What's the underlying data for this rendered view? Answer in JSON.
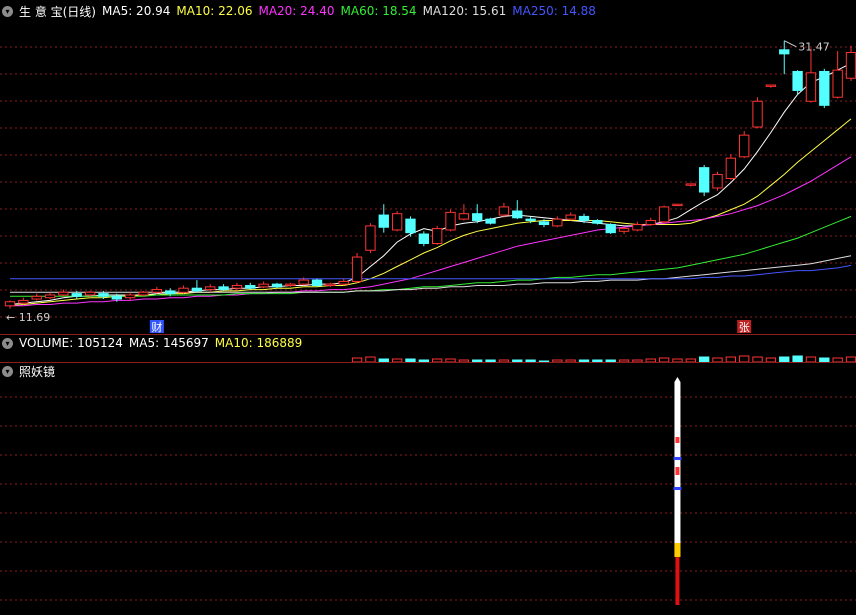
{
  "main_header": {
    "title": "生 意 宝(日线)",
    "indicators": [
      {
        "label": "MA5: 20.94",
        "color": "#ffffff"
      },
      {
        "label": "MA10: 22.06",
        "color": "#ffff44"
      },
      {
        "label": "MA20: 24.40",
        "color": "#ff33ff"
      },
      {
        "label": "MA60: 18.54",
        "color": "#33ee33"
      },
      {
        "label": "MA120: 15.61",
        "color": "#dddddd"
      },
      {
        "label": "MA250: 14.88",
        "color": "#4455ff"
      }
    ]
  },
  "volume_header": {
    "indicators": [
      {
        "label": "VOLUME: 105124",
        "color": "#ffffff"
      },
      {
        "label": "MA5: 145697",
        "color": "#ffffff"
      },
      {
        "label": "MA10: 186889",
        "color": "#ffff44"
      }
    ]
  },
  "indicator_header": {
    "title": "照妖镜"
  },
  "colors": {
    "up": "#ff3333",
    "down": "#54ffff",
    "grid": "#8a1e1e"
  },
  "chart_data": {
    "type": "candlestick",
    "price_range": [
      11.0,
      33.0
    ],
    "high_label": "31.47",
    "low_label": "11.69",
    "markers": [
      {
        "index": 11,
        "text": "财",
        "color": "#3355ff"
      },
      {
        "index": 55,
        "text": "张",
        "color": "#bb2222"
      }
    ],
    "candles": [
      [
        11.9,
        12.2,
        11.69,
        12.3
      ],
      [
        12.1,
        12.3,
        12.0,
        12.5
      ],
      [
        12.4,
        12.6,
        12.3,
        12.8
      ],
      [
        12.5,
        12.7,
        12.4,
        12.9
      ],
      [
        12.7,
        12.9,
        12.6,
        13.1
      ],
      [
        12.8,
        12.6,
        12.4,
        13.0
      ],
      [
        12.7,
        12.9,
        12.5,
        13.0
      ],
      [
        12.8,
        12.6,
        12.4,
        13.0
      ],
      [
        12.6,
        12.4,
        12.2,
        12.8
      ],
      [
        12.5,
        12.7,
        12.3,
        12.9
      ],
      [
        12.7,
        12.9,
        12.6,
        13.0
      ],
      [
        12.9,
        13.1,
        12.8,
        13.3
      ],
      [
        13.0,
        12.8,
        12.6,
        13.2
      ],
      [
        12.9,
        13.2,
        12.8,
        13.4
      ],
      [
        13.2,
        13.0,
        12.9,
        13.8
      ],
      [
        13.1,
        13.3,
        12.9,
        13.5
      ],
      [
        13.3,
        13.1,
        13.0,
        13.5
      ],
      [
        13.2,
        13.4,
        13.0,
        13.6
      ],
      [
        13.4,
        13.2,
        13.1,
        13.6
      ],
      [
        13.3,
        13.5,
        13.2,
        13.7
      ],
      [
        13.5,
        13.3,
        13.2,
        13.6
      ],
      [
        13.4,
        13.5,
        13.3,
        13.6
      ],
      [
        13.5,
        13.8,
        13.4,
        14.0
      ],
      [
        13.8,
        13.4,
        13.3,
        13.9
      ],
      [
        13.4,
        13.5,
        13.3,
        13.6
      ],
      [
        13.5,
        13.7,
        13.4,
        13.9
      ],
      [
        13.7,
        15.5,
        13.6,
        15.8
      ],
      [
        16.0,
        17.8,
        15.8,
        18.0
      ],
      [
        18.6,
        17.7,
        17.3,
        19.4
      ],
      [
        17.5,
        18.7,
        17.4,
        18.9
      ],
      [
        18.3,
        17.3,
        17.0,
        18.5
      ],
      [
        17.2,
        16.5,
        16.3,
        17.4
      ],
      [
        16.5,
        17.6,
        16.4,
        17.8
      ],
      [
        17.5,
        18.8,
        17.4,
        19.0
      ],
      [
        18.3,
        18.7,
        18.2,
        19.4
      ],
      [
        18.7,
        18.2,
        18.0,
        19.4
      ],
      [
        18.3,
        18.0,
        17.9,
        18.4
      ],
      [
        18.6,
        19.2,
        18.4,
        19.5
      ],
      [
        18.9,
        18.4,
        18.3,
        19.7
      ],
      [
        18.3,
        18.2,
        18.0,
        18.5
      ],
      [
        18.1,
        17.9,
        17.7,
        18.3
      ],
      [
        17.8,
        18.3,
        17.7,
        18.5
      ],
      [
        18.3,
        18.6,
        18.2,
        18.8
      ],
      [
        18.5,
        18.2,
        18.0,
        18.7
      ],
      [
        18.2,
        18.0,
        17.9,
        18.3
      ],
      [
        17.9,
        17.3,
        17.2,
        18.0
      ],
      [
        17.4,
        17.6,
        17.2,
        17.7
      ],
      [
        17.5,
        17.9,
        17.4,
        18.1
      ],
      [
        17.9,
        18.2,
        17.8,
        18.4
      ],
      [
        18.1,
        19.2,
        18.0,
        19.3
      ],
      [
        19.3,
        19.4,
        19.3,
        19.4
      ],
      [
        20.8,
        20.9,
        20.7,
        20.9
      ],
      [
        22.1,
        20.3,
        20.0,
        22.3
      ],
      [
        20.6,
        21.6,
        20.4,
        21.8
      ],
      [
        21.3,
        22.8,
        21.2,
        23.1
      ],
      [
        22.9,
        24.5,
        22.8,
        24.8
      ],
      [
        25.1,
        27.0,
        25.0,
        27.3
      ],
      [
        28.1,
        28.2,
        28.0,
        28.2
      ],
      [
        30.8,
        30.5,
        29.0,
        31.47
      ],
      [
        29.2,
        27.8,
        27.5,
        29.3
      ],
      [
        27.0,
        29.1,
        26.9,
        30.9
      ],
      [
        29.2,
        26.7,
        26.5,
        29.4
      ],
      [
        27.3,
        29.3,
        27.2,
        30.7
      ],
      [
        28.7,
        30.6,
        28.5,
        31.1
      ]
    ],
    "ma_lines": [
      {
        "name": "MA5",
        "color": "#ffffff",
        "values": [
          12.0,
          12.1,
          12.2,
          12.3,
          12.5,
          12.6,
          12.6,
          12.7,
          12.7,
          12.7,
          12.7,
          12.8,
          12.9,
          12.9,
          13.0,
          13.1,
          13.1,
          13.2,
          13.2,
          13.3,
          13.3,
          13.4,
          13.4,
          13.5,
          13.5,
          13.6,
          14.0,
          14.8,
          15.6,
          16.6,
          17.2,
          17.6,
          17.4,
          17.8,
          18.0,
          18.1,
          18.3,
          18.5,
          18.6,
          18.5,
          18.4,
          18.3,
          18.2,
          18.1,
          18.0,
          17.9,
          17.8,
          17.8,
          17.9,
          18.1,
          18.4,
          19.0,
          19.6,
          20.1,
          21.0,
          22.0,
          23.3,
          24.7,
          26.2,
          27.5,
          28.4,
          28.8,
          29.3,
          29.8
        ]
      },
      {
        "name": "MA10",
        "color": "#ffff44",
        "values": [
          11.9,
          12.0,
          12.1,
          12.2,
          12.3,
          12.4,
          12.5,
          12.5,
          12.6,
          12.6,
          12.7,
          12.7,
          12.8,
          12.8,
          12.9,
          12.9,
          13.0,
          13.0,
          13.1,
          13.1,
          13.2,
          13.2,
          13.3,
          13.3,
          13.4,
          13.4,
          13.6,
          13.9,
          14.3,
          14.8,
          15.3,
          15.8,
          16.2,
          16.7,
          17.1,
          17.4,
          17.6,
          17.8,
          18.0,
          18.1,
          18.2,
          18.2,
          18.2,
          18.2,
          18.2,
          18.1,
          18.0,
          17.9,
          17.9,
          17.9,
          17.9,
          18.0,
          18.3,
          18.6,
          19.0,
          19.4,
          20.0,
          20.8,
          21.6,
          22.5,
          23.3,
          24.1,
          24.9,
          25.7
        ]
      },
      {
        "name": "MA20",
        "color": "#ff33ff",
        "values": [
          11.9,
          11.9,
          12.0,
          12.0,
          12.1,
          12.1,
          12.2,
          12.2,
          12.3,
          12.3,
          12.4,
          12.4,
          12.5,
          12.5,
          12.6,
          12.6,
          12.7,
          12.7,
          12.8,
          12.8,
          12.9,
          12.9,
          13.0,
          13.0,
          13.1,
          13.1,
          13.2,
          13.3,
          13.5,
          13.7,
          13.9,
          14.2,
          14.5,
          14.8,
          15.1,
          15.4,
          15.7,
          16.0,
          16.3,
          16.5,
          16.7,
          16.9,
          17.1,
          17.3,
          17.5,
          17.6,
          17.7,
          17.8,
          17.9,
          18.0,
          18.1,
          18.2,
          18.3,
          18.5,
          18.7,
          19.0,
          19.3,
          19.7,
          20.1,
          20.6,
          21.1,
          21.7,
          22.3,
          22.9
        ]
      },
      {
        "name": "MA60",
        "color": "#33ee33",
        "values": [
          12.6,
          12.6,
          12.6,
          12.6,
          12.6,
          12.6,
          12.6,
          12.6,
          12.6,
          12.6,
          12.6,
          12.7,
          12.7,
          12.7,
          12.7,
          12.7,
          12.7,
          12.8,
          12.8,
          12.8,
          12.8,
          12.8,
          12.9,
          12.9,
          12.9,
          12.9,
          13.0,
          13.0,
          13.1,
          13.1,
          13.2,
          13.3,
          13.3,
          13.4,
          13.5,
          13.6,
          13.6,
          13.7,
          13.8,
          13.8,
          13.9,
          14.0,
          14.0,
          14.1,
          14.2,
          14.2,
          14.3,
          14.4,
          14.5,
          14.6,
          14.7,
          14.9,
          15.1,
          15.3,
          15.5,
          15.7,
          16.0,
          16.3,
          16.6,
          16.9,
          17.3,
          17.7,
          18.1,
          18.5
        ]
      },
      {
        "name": "MA120",
        "color": "#dddddd",
        "values": [
          12.9,
          12.9,
          12.9,
          12.9,
          12.9,
          12.9,
          12.9,
          12.9,
          12.9,
          12.9,
          12.9,
          12.9,
          12.9,
          12.9,
          12.9,
          12.9,
          12.9,
          12.9,
          12.9,
          12.9,
          12.9,
          12.9,
          12.9,
          12.9,
          12.9,
          12.9,
          13.0,
          13.0,
          13.0,
          13.1,
          13.1,
          13.2,
          13.2,
          13.3,
          13.3,
          13.4,
          13.4,
          13.4,
          13.5,
          13.5,
          13.6,
          13.6,
          13.6,
          13.7,
          13.7,
          13.8,
          13.8,
          13.8,
          13.9,
          13.9,
          14.0,
          14.1,
          14.2,
          14.3,
          14.4,
          14.5,
          14.6,
          14.7,
          14.8,
          14.9,
          15.0,
          15.2,
          15.4,
          15.6
        ]
      },
      {
        "name": "MA250",
        "color": "#4455ff",
        "values": [
          13.9,
          13.9,
          13.9,
          13.9,
          13.9,
          13.9,
          13.9,
          13.9,
          13.9,
          13.9,
          13.9,
          13.9,
          13.9,
          13.9,
          13.9,
          13.9,
          13.9,
          13.9,
          13.9,
          13.9,
          13.9,
          13.9,
          13.9,
          13.9,
          13.9,
          13.9,
          13.9,
          13.9,
          13.9,
          13.9,
          13.9,
          13.9,
          13.9,
          13.9,
          13.9,
          13.9,
          13.9,
          13.9,
          13.9,
          13.9,
          13.9,
          13.9,
          13.9,
          13.9,
          13.9,
          13.9,
          13.9,
          13.9,
          13.9,
          13.9,
          13.9,
          13.9,
          14.0,
          14.0,
          14.1,
          14.1,
          14.2,
          14.3,
          14.4,
          14.5,
          14.5,
          14.6,
          14.7,
          14.88
        ]
      }
    ],
    "volume": [
      0,
      0,
      0,
      0,
      0,
      0,
      0,
      0,
      0,
      0,
      0,
      0,
      0,
      0,
      0,
      0,
      0,
      0,
      0,
      0,
      0,
      0,
      0,
      0,
      0,
      0,
      4,
      5,
      3,
      3,
      3,
      2,
      3,
      3,
      2,
      2,
      2,
      2,
      2,
      2,
      1,
      2,
      2,
      2,
      2,
      2,
      2,
      2,
      3,
      4,
      3,
      3,
      5,
      4,
      5,
      6,
      5,
      4,
      5,
      6,
      5,
      4,
      4,
      5
    ],
    "indicator": {
      "index": 50,
      "top": 1.0,
      "bottom": 0.0
    }
  }
}
